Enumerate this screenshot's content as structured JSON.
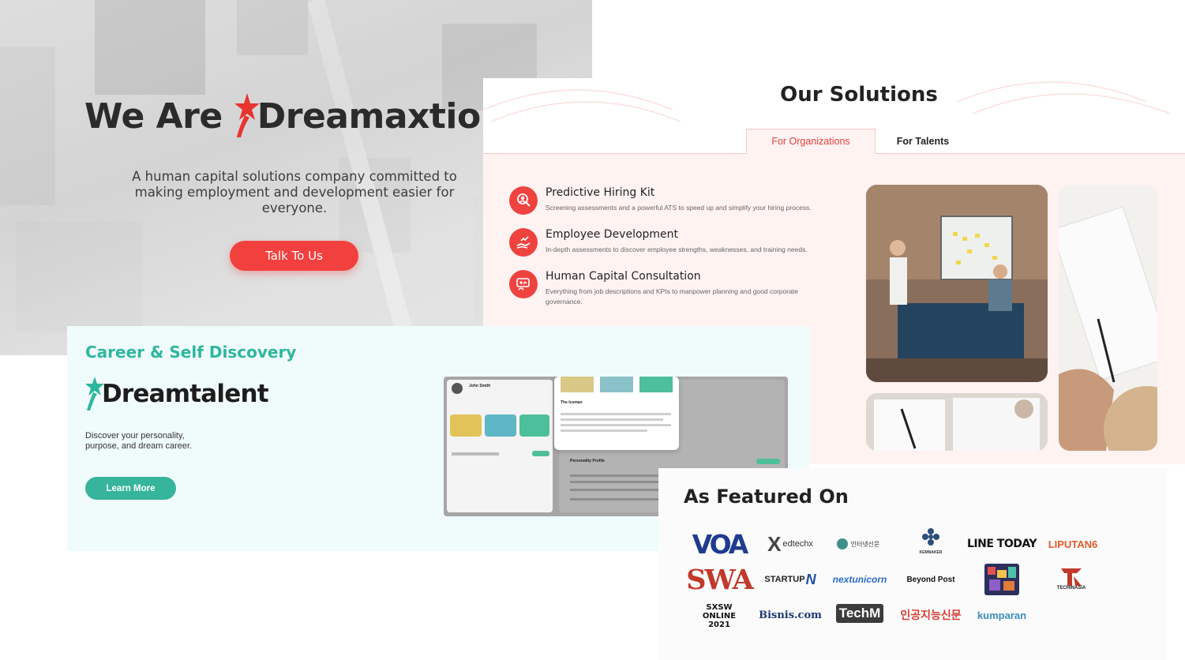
{
  "hero": {
    "title_prefix": "We Are",
    "brand": "Dreamaxtion",
    "subtitle": "A human capital solutions company committed to making employment and development easier for everyone.",
    "cta_label": "Talk To Us"
  },
  "solutions": {
    "title": "Our Solutions",
    "tabs": [
      {
        "label": "For Organizations",
        "active": true
      },
      {
        "label": "For Talents",
        "active": false
      }
    ],
    "items": [
      {
        "name": "Predictive Hiring Kit",
        "description": "Screening assessments and a powerful ATS to speed up and simplify your hiring process.",
        "icon": "person-search-icon"
      },
      {
        "name": "Employee Development",
        "description": "In-depth assessments to discover employee strengths, weaknesses, and training needs.",
        "icon": "hand-growth-icon"
      },
      {
        "name": "Human Capital Consultation",
        "description": "Everything from job descriptions and KPIs to manpower planning and good corporate governance.",
        "icon": "consultation-icon"
      }
    ],
    "accent_color": "#ef4340"
  },
  "career": {
    "heading": "Career & Self Discovery",
    "brand": "Dreamtalent",
    "description": "Discover your personality, purpose, and dream career.",
    "cta_label": "Learn More",
    "accent_color": "#36b49c",
    "mock": {
      "user_name": "John Smith",
      "popup_title": "The Iceman",
      "section_label": "Personality Profile"
    }
  },
  "featured": {
    "heading": "As Featured On",
    "logos": [
      {
        "name": "VOA"
      },
      {
        "name": "edtechx"
      },
      {
        "name": "인터넷신문"
      },
      {
        "name": "KEMNAKER"
      },
      {
        "name": "LINE TODAY"
      },
      {
        "name": "LIPUTAN6"
      },
      {
        "name": "SWA"
      },
      {
        "name": "STARTUP"
      },
      {
        "name": "nextunicorn"
      },
      {
        "name": "Beyond Post"
      },
      {
        "name": "ARCHIPELAGEEK"
      },
      {
        "name": "TECHINASIA"
      },
      {
        "name": "SXSW ONLINE 2021"
      },
      {
        "name": "Bisnis.com"
      },
      {
        "name": "TechM"
      },
      {
        "name": "인공지능신문"
      },
      {
        "name": "kumparan"
      }
    ]
  }
}
